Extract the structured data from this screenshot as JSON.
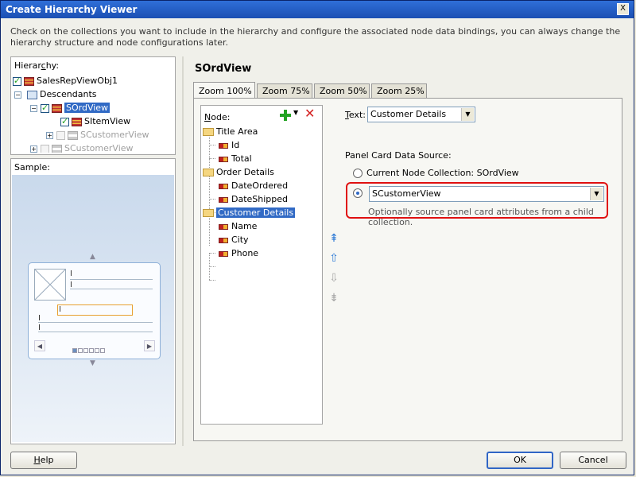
{
  "window": {
    "title": "Create Hierarchy Viewer",
    "close_label": "X"
  },
  "description": "Check on the collections you want to include in the hierarchy and configure the associated node data bindings, you can always change the hierarchy structure and node configurations later.",
  "hierarchy": {
    "label_before": "Hierar",
    "label_mnemonic": "c",
    "label_after": "hy:",
    "nodes": [
      {
        "label": "SalesRepViewObj1"
      },
      {
        "label": "Descendants"
      },
      {
        "label": "SOrdView"
      },
      {
        "label": "SItemView"
      },
      {
        "label": "SCustomerView"
      },
      {
        "label": "SCustomerView"
      }
    ]
  },
  "sample": {
    "label": "Sample:"
  },
  "right_panel": {
    "title": "SOrdView",
    "tabs": [
      {
        "label": "Zoom 100%"
      },
      {
        "label": "Zoom 75%"
      },
      {
        "label": "Zoom 50%"
      },
      {
        "label": "Zoom 25%"
      }
    ]
  },
  "node_panel": {
    "label_mnemonic": "N",
    "label_after": "ode:",
    "groups": [
      {
        "label": "Title Area",
        "attrs": [
          "Id",
          "Total"
        ]
      },
      {
        "label": "Order Details",
        "attrs": [
          "DateOrdered",
          "DateShipped"
        ]
      },
      {
        "label": "Customer Details",
        "attrs": [
          "Name",
          "City",
          "Phone"
        ]
      }
    ]
  },
  "text_field": {
    "label_mnemonic": "T",
    "label_after": "ext:",
    "value": "Customer Details"
  },
  "panel_card": {
    "label": "Panel Card Data Source:",
    "option_current": "Current Node Collection: SOrdView",
    "option_child_value": "SCustomerView",
    "hint": "Optionally source panel card attributes from a child collection."
  },
  "footer": {
    "help_mnemonic": "H",
    "help_after": "elp",
    "ok": "OK",
    "cancel": "Cancel"
  }
}
